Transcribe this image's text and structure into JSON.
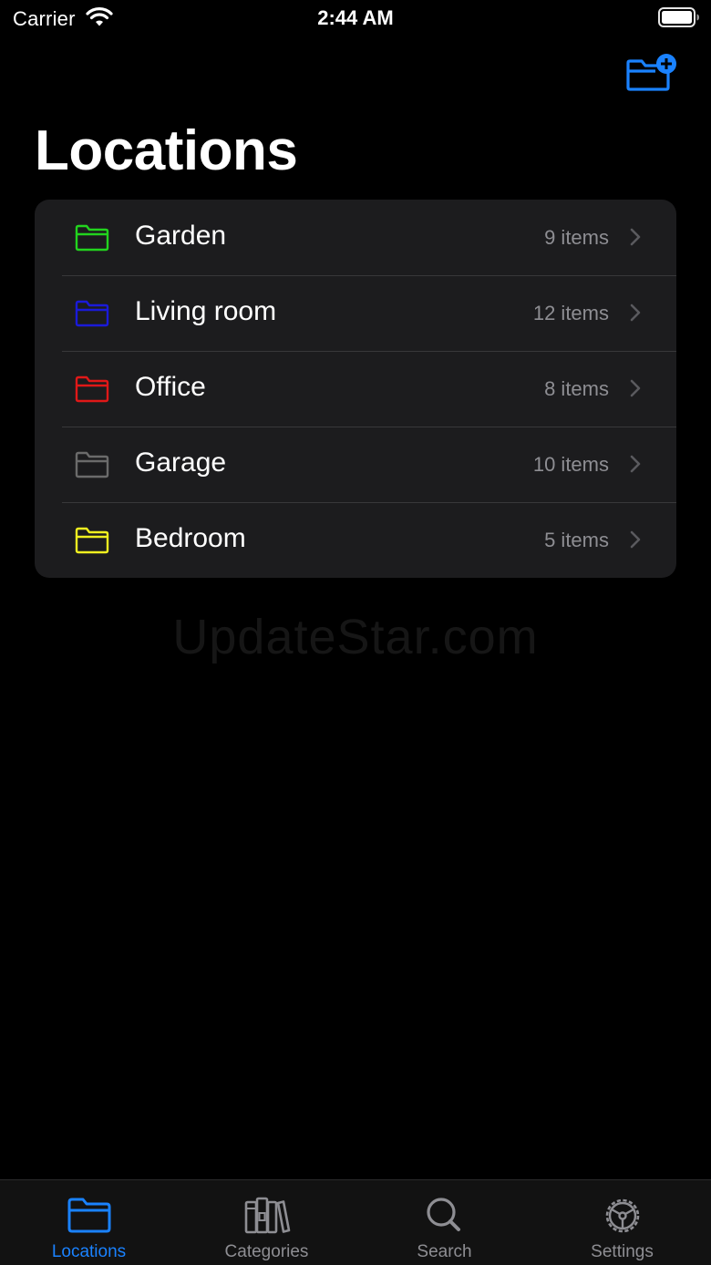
{
  "status_bar": {
    "carrier": "Carrier",
    "time": "2:44 AM"
  },
  "header": {
    "title": "Locations",
    "add_button_icon": "folder-badge-plus-icon"
  },
  "locations": [
    {
      "label": "Garden",
      "count": "9 items",
      "color": "#22d41e"
    },
    {
      "label": "Living room",
      "count": "12 items",
      "color": "#1a1ad9"
    },
    {
      "label": "Office",
      "count": "8 items",
      "color": "#e01818"
    },
    {
      "label": "Garage",
      "count": "10 items",
      "color": "#6b6b6b"
    },
    {
      "label": "Bedroom",
      "count": "5 items",
      "color": "#f0f020"
    }
  ],
  "watermark": "UpdateStar.com",
  "tab_bar": {
    "tabs": [
      {
        "label": "Locations",
        "icon": "folder-icon",
        "active": true
      },
      {
        "label": "Categories",
        "icon": "books-icon",
        "active": false
      },
      {
        "label": "Search",
        "icon": "magnifying-glass-icon",
        "active": false
      },
      {
        "label": "Settings",
        "icon": "gear-icon",
        "active": false
      }
    ]
  },
  "colors": {
    "accent": "#1a82ff",
    "background": "#000000",
    "list_background": "#1c1c1e",
    "secondary_text": "#8e8e93"
  }
}
